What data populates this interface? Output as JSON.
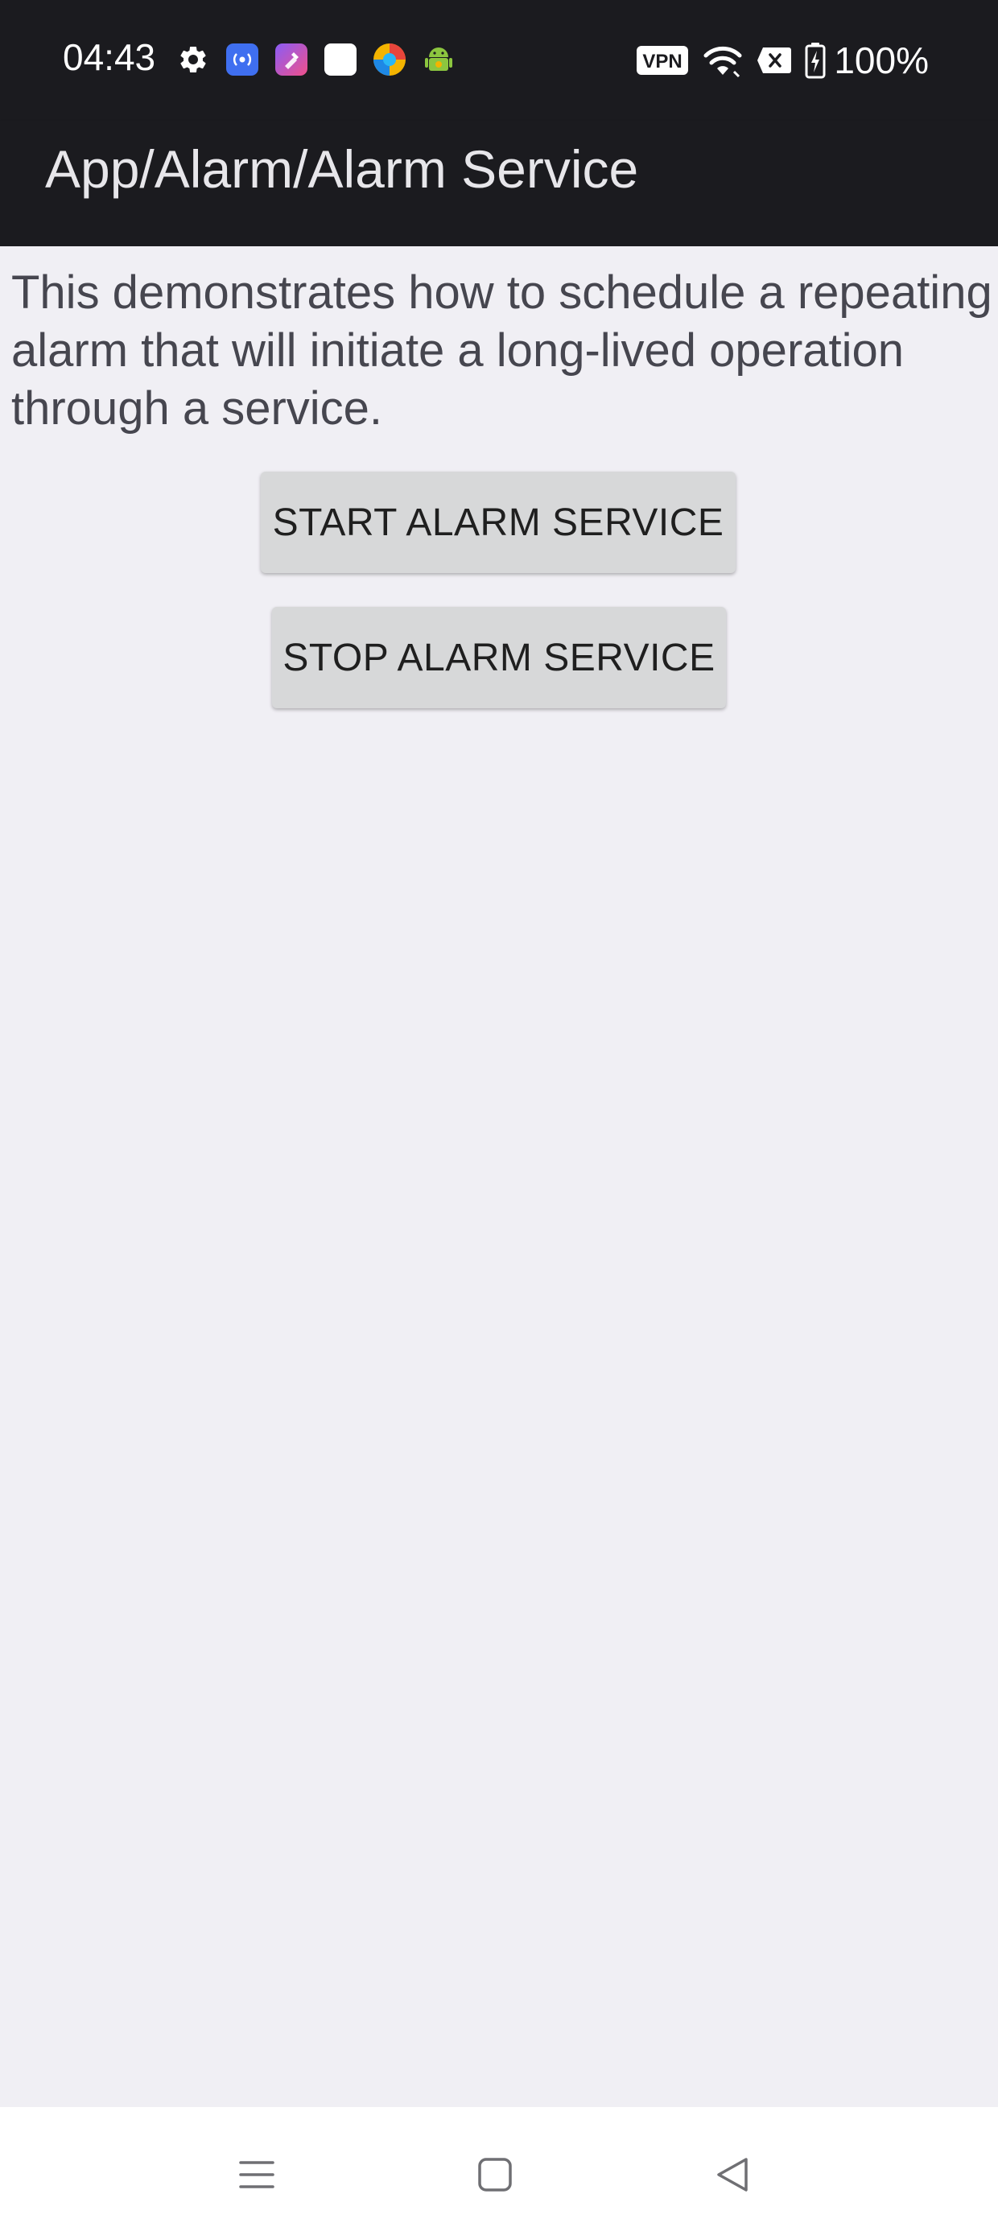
{
  "status_bar": {
    "time": "04:43",
    "battery_text": "100%",
    "vpn_label": "VPN",
    "icons_left": [
      "settings-icon",
      "broadcast-app-icon",
      "shortcut-app-icon",
      "white-square-app-icon",
      "browser-app-icon",
      "android-app-icon"
    ],
    "icons_right": [
      "vpn-icon",
      "wifi-icon",
      "no-sim-icon",
      "battery-charging-icon"
    ]
  },
  "app_bar": {
    "title": "App/Alarm/Alarm Service"
  },
  "main": {
    "description": "This demonstrates how to schedule a repeating alarm that will initiate a long-lived operation through a service.",
    "start_button_label": "START ALARM SERVICE",
    "stop_button_label": "STOP ALARM SERVICE"
  },
  "nav_bar": {
    "icons": [
      "recents-menu-icon",
      "home-icon",
      "back-icon"
    ]
  },
  "colors": {
    "status_bar_bg": "#1b1b1f",
    "app_bar_bg": "#1b1b1f",
    "content_bg": "#f0eff4",
    "button_bg": "#d7d8d9",
    "nav_bar_bg": "#ffffff",
    "text_primary": "#46464f"
  }
}
